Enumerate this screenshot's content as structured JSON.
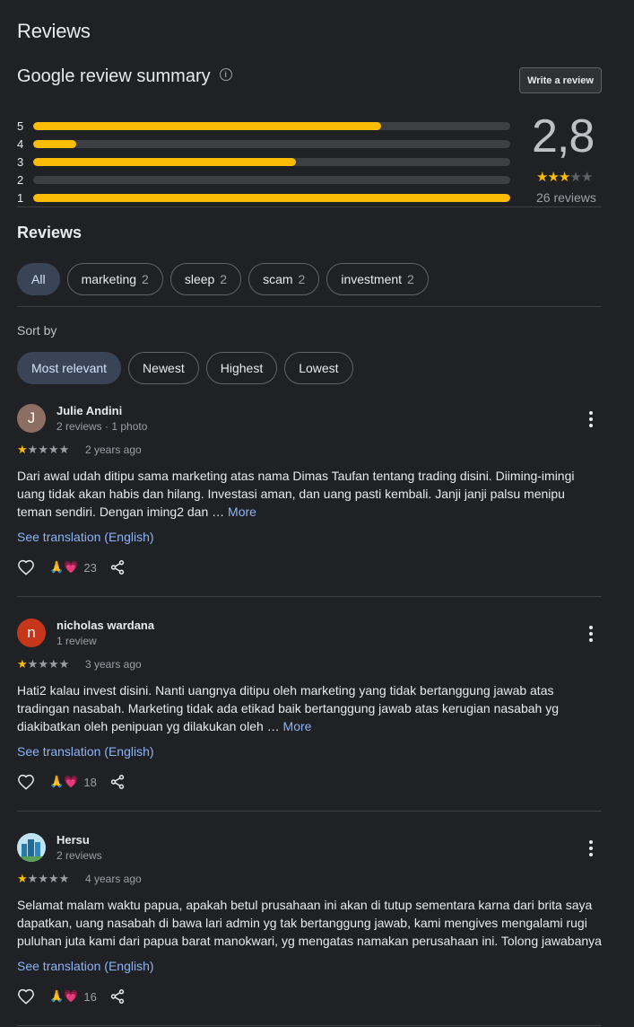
{
  "header": {
    "title": "Reviews"
  },
  "summary": {
    "title": "Google review summary",
    "write_label": "Write a review",
    "rating": "2,8",
    "rating_value": 2.8,
    "review_count": "26 reviews",
    "stars_filled": 3,
    "bars": [
      {
        "label": "5",
        "fraction": 0.73
      },
      {
        "label": "4",
        "fraction": 0.09
      },
      {
        "label": "3",
        "fraction": 0.55
      },
      {
        "label": "2",
        "fraction": 0.0
      },
      {
        "label": "1",
        "fraction": 1.0
      }
    ]
  },
  "reviews_section": {
    "title": "Reviews",
    "topics": [
      {
        "label": "All",
        "count": ""
      },
      {
        "label": "marketing",
        "count": "2"
      },
      {
        "label": "sleep",
        "count": "2"
      },
      {
        "label": "scam",
        "count": "2"
      },
      {
        "label": "investment",
        "count": "2"
      }
    ],
    "sort_label": "Sort by",
    "sort_options": [
      "Most relevant",
      "Newest",
      "Highest",
      "Lowest"
    ]
  },
  "reviews": [
    {
      "avatar_letter": "J",
      "avatar_color": "#8d6e63",
      "name": "Julie Andini",
      "meta": "2 reviews · 1 photo",
      "rating": 1,
      "date": "2 years ago",
      "text": "Dari awal udah ditipu sama marketing atas nama Dimas Taufan tentang trading disini. Diiming-imingi uang tidak akan habis dan hilang. Investasi aman, dan uang pasti kembali. Janji janji palsu menipu teman sendiri. Dengan iming2 dan … ",
      "more": "More",
      "translation": "See translation (English)",
      "reaction_emoji": "🙏💗",
      "reaction_count": "23"
    },
    {
      "avatar_letter": "n",
      "avatar_color": "#c5361b",
      "name": "nicholas wardana",
      "meta": "1 review",
      "rating": 1,
      "date": "3 years ago",
      "text": "Hati2 kalau invest disini. Nanti uangnya ditipu oleh marketing yang tidak bertanggung jawab atas tradingan nasabah. Marketing tidak ada etikad baik bertanggung jawab atas kerugian nasabah yg diakibatkan oleh penipuan yg dilakukan oleh … ",
      "more": "More",
      "translation": "See translation (English)",
      "reaction_emoji": "🙏💗",
      "reaction_count": "18"
    },
    {
      "avatar_letter": "",
      "avatar_color": "#4aa3c9",
      "name": "Hersu",
      "meta": "2 reviews",
      "rating": 1,
      "date": "4 years ago",
      "text": "Selamat malam waktu papua, apakah betul prusahaan ini akan di tutup sementara karna dari brita saya dapatkan, uang nasabah di bawa lari admin yg tak bertanggung jawab, kami mengives mengalami rugi puluhan juta kami dari papua barat manokwari, yg mengatas namakan perusahaan ini. Tolong jawabanya",
      "more": "",
      "translation": "See translation (English)",
      "reaction_emoji": "🙏💗",
      "reaction_count": "16"
    }
  ],
  "colors": {
    "accent": "#fbbc04",
    "link": "#8ab4f8",
    "chip_active": "#394457"
  }
}
